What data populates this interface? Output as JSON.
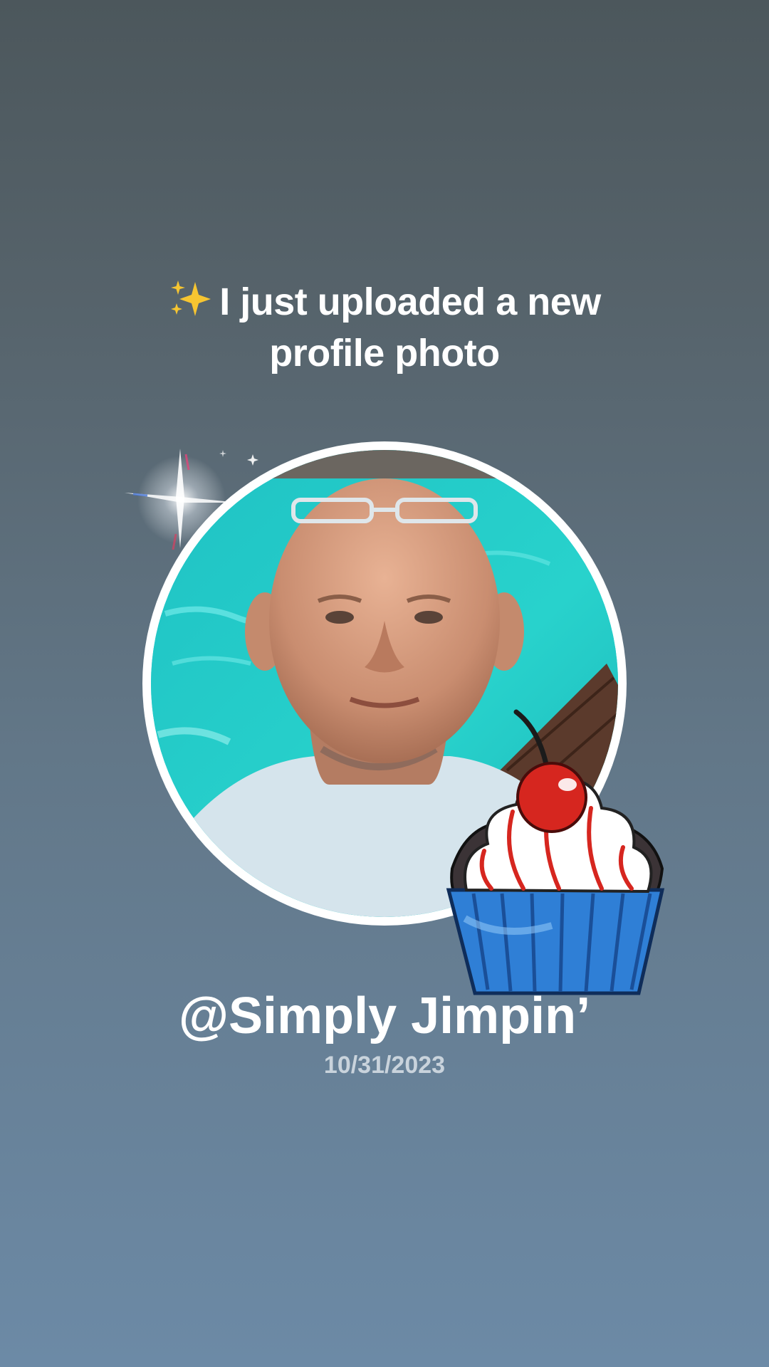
{
  "post": {
    "headline_line1": "I just uploaded a new",
    "headline_line2": "profile photo",
    "username": "@Simply Jimpin’",
    "date": "10/31/2023"
  },
  "icons": {
    "headline_emoji": "sparkles-icon",
    "flare": "lens-flare-sparkle-icon",
    "sticker": "cupcake-with-cherry-icon"
  },
  "colors": {
    "text": "#ffffff",
    "date_text": "#c9d3dc",
    "ring": "#ffffff",
    "pool": "#22c9c9",
    "cupcake_liner": "#2f7fd6",
    "cherry": "#d6261f"
  }
}
